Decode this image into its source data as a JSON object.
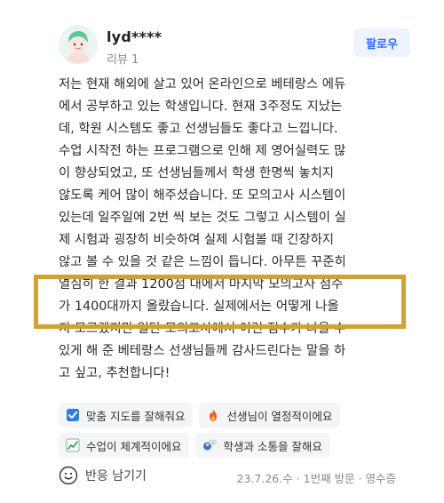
{
  "reviewer": {
    "username": "lyd****",
    "review_count": "리뷰 1",
    "follow_label": "팔로우"
  },
  "review": {
    "lines": [
      "저는 현재 해외에 살고 있어 온라인으로 베테랑스 에듀",
      "에서 공부하고 있는 학생입니다. 현재 3주정도 지났는",
      "데, 학원 시스템도 좋고 선생님들도 좋다고 느낍니다.",
      "수업 시작전 하는 프로그램으로 인해 제 영어실력도 많",
      "이 향상되었고, 또 선생님들께서 학생 한명씩 놓치지",
      "않도록 케어 많이 해주셨습니다. 또 모의고사 시스템이",
      "있는데 일주일에 2번 씩 보는 것도 그렇고 시스템이 실",
      "제 시험과 굉장히 비슷하여 실제 시험볼 때 긴장하지",
      "않고 볼 수 있을 것 같은 느낌이 듭니다. 아무튼 꾸준히",
      "열심히 한 결과 1200점 대에서 마지막 모의고사 점수",
      "가 1400대까지 올랐습니다. 실제에서는 어떻게 나올",
      "지 모르겠지만 일단 모의고사에서 이런 점수가 나올 수",
      "있게 해 준 베테랑스 선생님들께 감사드린다는 말을 하",
      "고 싶고, 추천합니다!"
    ]
  },
  "tags": [
    {
      "label": "맞춤 지도를 잘해줘요",
      "icon": "checkbox-icon"
    },
    {
      "label": "선생님이 열정적이에요",
      "icon": "fire-icon"
    },
    {
      "label": "수업이 체계적이에요",
      "icon": "chart-icon"
    },
    {
      "label": "학생과 소통을 잘해요",
      "icon": "chat-icon"
    }
  ],
  "footer": {
    "react_label": "반응 남기기",
    "meta": "23.7.26.수 · 1번째 방문 · 영수증"
  },
  "colors": {
    "highlight_border": "#d2a22f",
    "follow_text": "#2e6bff",
    "follow_bg": "#eef4ff"
  }
}
